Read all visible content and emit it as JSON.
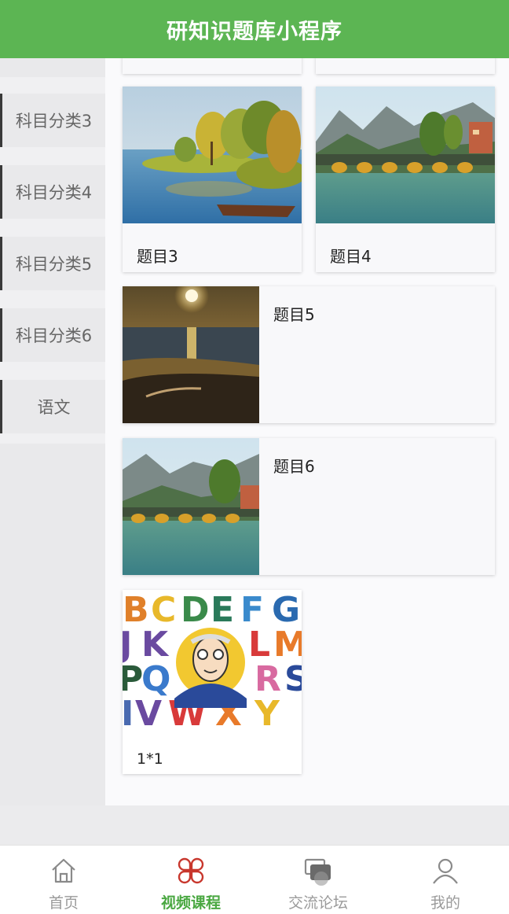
{
  "app": {
    "title": "研知识题库小程序"
  },
  "sidebar": {
    "items": [
      {
        "label": "科目分类3"
      },
      {
        "label": "科目分类4"
      },
      {
        "label": "科目分类5"
      },
      {
        "label": "科目分类6"
      },
      {
        "label": "语文"
      }
    ]
  },
  "courses": [
    {
      "title": "题目3",
      "image": "lake-island-painting"
    },
    {
      "title": "题目4",
      "image": "river-bridge-mountains"
    },
    {
      "title": "题目5",
      "image": "sunset-beach"
    },
    {
      "title": "题目6",
      "image": "river-bridge-mountains"
    },
    {
      "title": "1*1",
      "image": "alphabet-cartoon"
    }
  ],
  "alphabet_letters": [
    "B",
    "C",
    "D",
    "E",
    "F",
    "G",
    "J",
    "K",
    "L",
    "M",
    "P",
    "Q",
    "R",
    "S",
    "I",
    "V",
    "W",
    "X",
    "Y"
  ],
  "tabbar": {
    "items": [
      {
        "label": "首页",
        "icon": "home-icon"
      },
      {
        "label": "视频课程",
        "icon": "clover-icon",
        "active": true
      },
      {
        "label": "交流论坛",
        "icon": "chat-icon"
      },
      {
        "label": "我的",
        "icon": "user-icon"
      }
    ]
  },
  "colors": {
    "brand_green": "#5cb553",
    "active_tab": "#4aa842",
    "active_icon": "#c8372d"
  }
}
